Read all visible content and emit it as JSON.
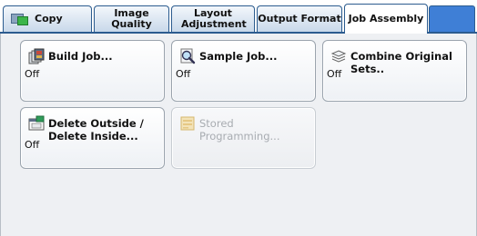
{
  "tabs": [
    {
      "label": "Copy",
      "active": false
    },
    {
      "label": "Image Quality",
      "active": false
    },
    {
      "label": "Layout Adjustment",
      "active": false
    },
    {
      "label": "Output Format",
      "active": false
    },
    {
      "label": "Job Assembly",
      "active": true
    }
  ],
  "features": {
    "build_job": {
      "label": "Build Job...",
      "value": "Off"
    },
    "sample_job": {
      "label": "Sample Job...",
      "value": "Off"
    },
    "combine_sets": {
      "label": "Combine Original Sets..",
      "value": "Off"
    },
    "delete_outside": {
      "label_line1": "Delete Outside /",
      "label_line2": "Delete Inside...",
      "value": "Off"
    },
    "stored_programming": {
      "label": "Stored Programming...",
      "enabled": false
    }
  },
  "colors": {
    "tab_border": "#2c5c8f",
    "accent_blue": "#3f7fd6",
    "panel_bg": "#eef0f3"
  }
}
